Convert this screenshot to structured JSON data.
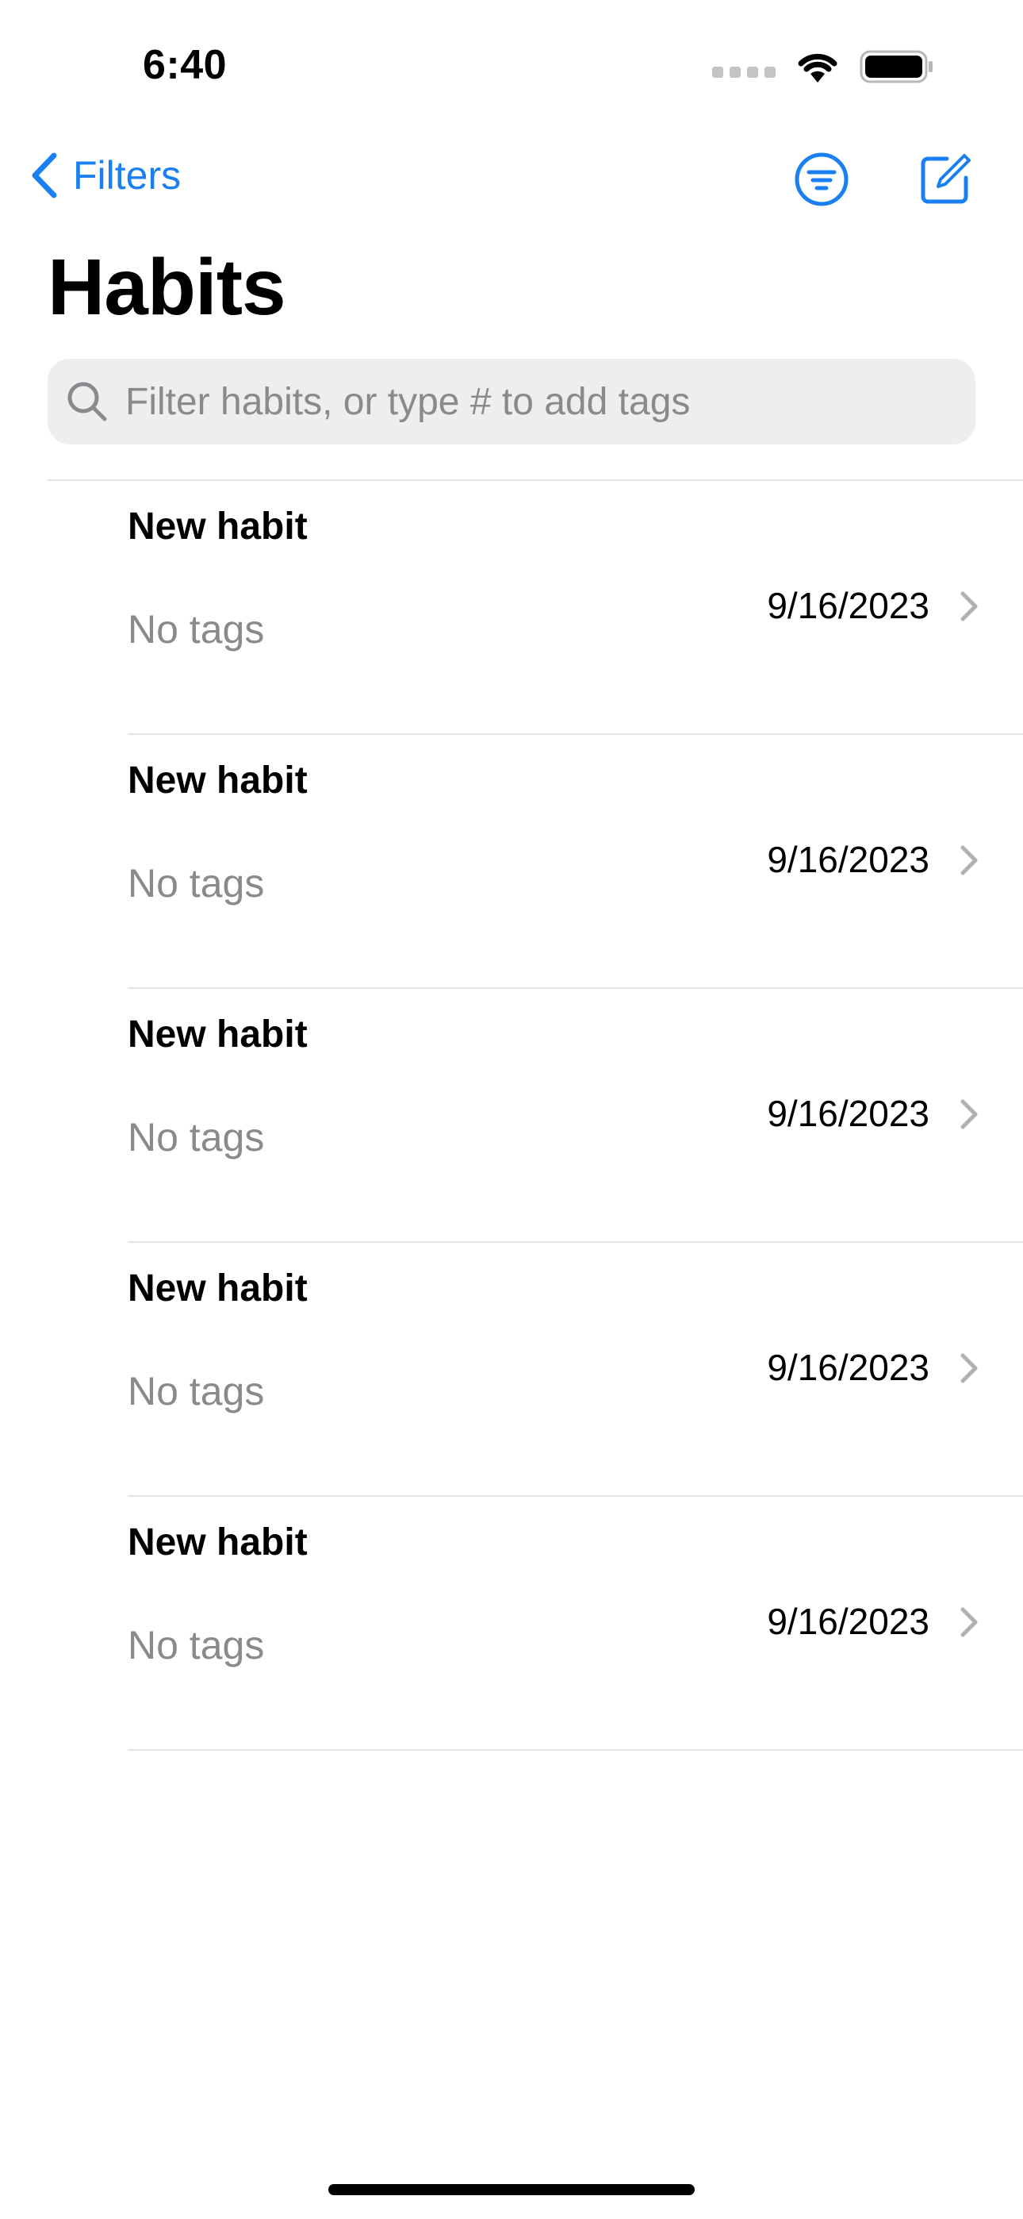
{
  "status_bar": {
    "time": "6:40"
  },
  "nav": {
    "back_label": "Filters"
  },
  "page_title": "Habits",
  "search": {
    "placeholder": "Filter habits, or type # to add tags",
    "value": ""
  },
  "habits": [
    {
      "title": "New habit",
      "tags": "No tags",
      "date": "9/16/2023"
    },
    {
      "title": "New habit",
      "tags": "No tags",
      "date": "9/16/2023"
    },
    {
      "title": "New habit",
      "tags": "No tags",
      "date": "9/16/2023"
    },
    {
      "title": "New habit",
      "tags": "No tags",
      "date": "9/16/2023"
    },
    {
      "title": "New habit",
      "tags": "No tags",
      "date": "9/16/2023"
    }
  ],
  "colors": {
    "accent": "#1a80f2",
    "secondary_text": "#8a8a8e",
    "search_bg": "#eeeeef"
  }
}
